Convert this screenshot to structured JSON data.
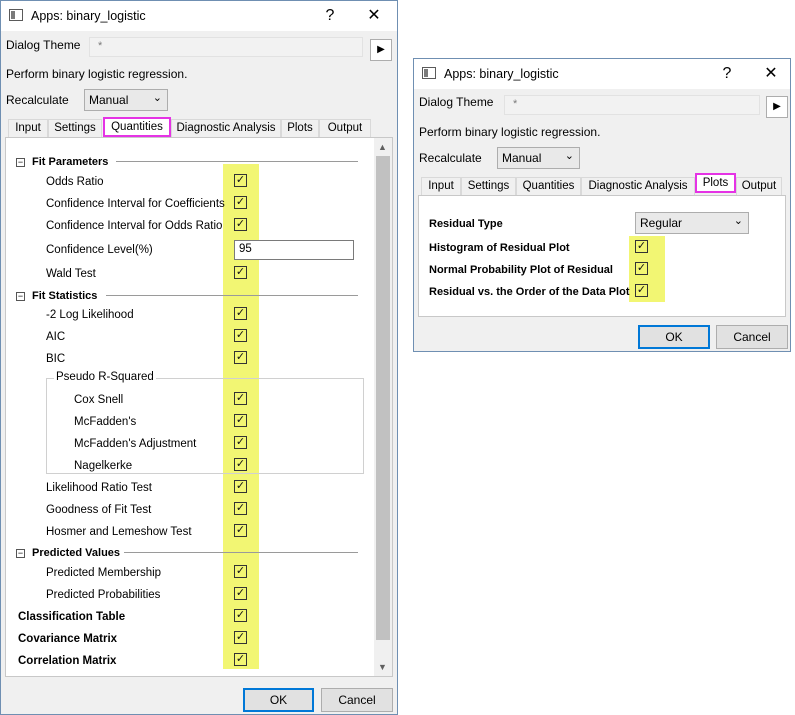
{
  "window_left": {
    "title": "Apps: binary_logistic",
    "help_glyph": "?",
    "close_glyph": "✕",
    "dialog_theme_label": "Dialog Theme",
    "dialog_theme_value": "*",
    "description": "Perform binary logistic regression.",
    "recalculate_label": "Recalculate",
    "recalculate_value": "Manual",
    "tabs": [
      "Input",
      "Settings",
      "Quantities",
      "Diagnostic Analysis",
      "Plots",
      "Output"
    ],
    "active_tab": "Quantities",
    "groups": {
      "fit_parameters": "Fit Parameters",
      "fit_statistics": "Fit Statistics",
      "pseudo_r_squared": "Pseudo R-Squared",
      "predicted_values": "Predicted Values"
    },
    "items": {
      "odds_ratio": "Odds Ratio",
      "ci_coefficients": "Confidence Interval for Coefficients",
      "ci_odds_ratio": "Confidence Interval for Odds Ratio",
      "confidence_level": "Confidence Level(%)",
      "confidence_level_value": "95",
      "wald_test": "Wald Test",
      "neg2_log_likelihood": "-2 Log Likelihood",
      "aic": "AIC",
      "bic": "BIC",
      "cox_snell": "Cox  Snell",
      "mcfadden": "McFadden's",
      "mcfadden_adj": "McFadden's Adjustment",
      "nagelkerke": "Nagelkerke",
      "likelihood_ratio": "Likelihood Ratio Test",
      "goodness_of_fit": "Goodness of Fit Test",
      "hosmer": "Hosmer and Lemeshow Test",
      "predicted_membership": "Predicted Membership",
      "predicted_probabilities": "Predicted Probabilities",
      "classification_table": "Classification Table",
      "covariance_matrix": "Covariance Matrix",
      "correlation_matrix": "Correlation Matrix"
    },
    "ok_label": "OK",
    "cancel_label": "Cancel"
  },
  "window_right": {
    "title": "Apps: binary_logistic",
    "help_glyph": "?",
    "close_glyph": "✕",
    "dialog_theme_label": "Dialog Theme",
    "dialog_theme_value": "*",
    "description": "Perform binary logistic regression.",
    "recalculate_label": "Recalculate",
    "recalculate_value": "Manual",
    "tabs": [
      "Input",
      "Settings",
      "Quantities",
      "Diagnostic Analysis",
      "Plots",
      "Output"
    ],
    "active_tab": "Plots",
    "residual_type_label": "Residual Type",
    "residual_type_value": "Regular",
    "histogram_label": "Histogram of Residual Plot",
    "normal_prob_label": "Normal Probability Plot of Residual",
    "residual_order_label": "Residual vs. the Order of the Data Plot",
    "ok_label": "OK",
    "cancel_label": "Cancel"
  },
  "glyphs": {
    "check": "✓",
    "play": "▶",
    "chevron_down": "⌄",
    "minus": "−",
    "scroll_up": "▲",
    "scroll_down": "▼"
  },
  "colors": {
    "highlight_yellow": "#f0f55a",
    "active_tab_border": "#e533e5",
    "default_button_border": "#0078d7"
  }
}
